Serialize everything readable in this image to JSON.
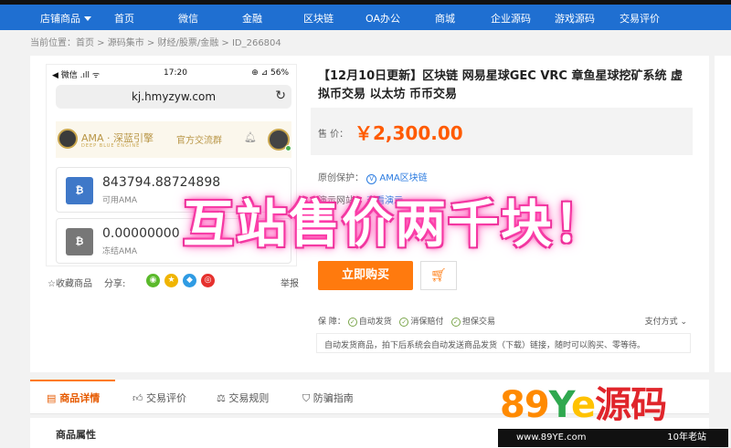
{
  "topnav": {
    "items": [
      "店铺商品",
      "首页",
      "微信",
      "金融",
      "区块链",
      "OA办公",
      "商城",
      "企业源码",
      "游戏源码",
      "交易评价"
    ]
  },
  "breadcrumb": "当前位置：首页 > 源码集市 > 财经/股票/金融 > ID_266804",
  "phone": {
    "status_left": "◀ 微信 .ıll ᯤ",
    "time": "17:20",
    "status_right": "⊕ ⊿ 56%",
    "url": "kj.hmyzyw.com",
    "ama_name": "AMA · 深蓝引擎",
    "ama_sub": "DEEP BLUE ENGINE",
    "ama_group": "官方交流群",
    "balances": [
      {
        "icon": "₿",
        "amount": "843794.88724898",
        "label": "可用AMA",
        "color": "#3f78c8"
      },
      {
        "icon": "₿",
        "amount": "0.00000000",
        "label": "冻结AMA",
        "color": "#777777"
      }
    ]
  },
  "share": {
    "fav": "☆收藏商品",
    "share": "分享:",
    "report": "举报"
  },
  "product": {
    "title": "【12月10日更新】区块链 网易星球GEC VRC 章鱼星球挖矿系统 虚拟币交易 以太坊 币币交易",
    "price_label": "售  价：",
    "price": "￥2,300.00",
    "origin_label": "原创保护：",
    "origin_value": "AMA区块链",
    "demo_label": "演示网站：",
    "demo_value": "查看演示",
    "buy": "立即购买"
  },
  "guarantee": {
    "label": "保  障：",
    "items": [
      "自动发货",
      "消保赔付",
      "担保交易"
    ],
    "pay": "支付方式",
    "note": "自动发货商品，拍下后系统会自动发送商品发货（下载）链接，随时可以购买、零等待。"
  },
  "tabs": [
    "商品详情",
    "交易评价",
    "交易规则",
    "防骗指南"
  ],
  "attrs_title": "商品属性",
  "overlay_text": "互站售价两千块！",
  "watermark": {
    "logo": [
      "89",
      "Y",
      "e",
      "源码"
    ],
    "url": "www.89YE.com",
    "slogan": "10年老站"
  },
  "colors": {
    "nav": "#1f6fd1",
    "price": "#ff5a00",
    "buy": "#ff7a0e",
    "overlay_glow": "#ff3aa8"
  }
}
